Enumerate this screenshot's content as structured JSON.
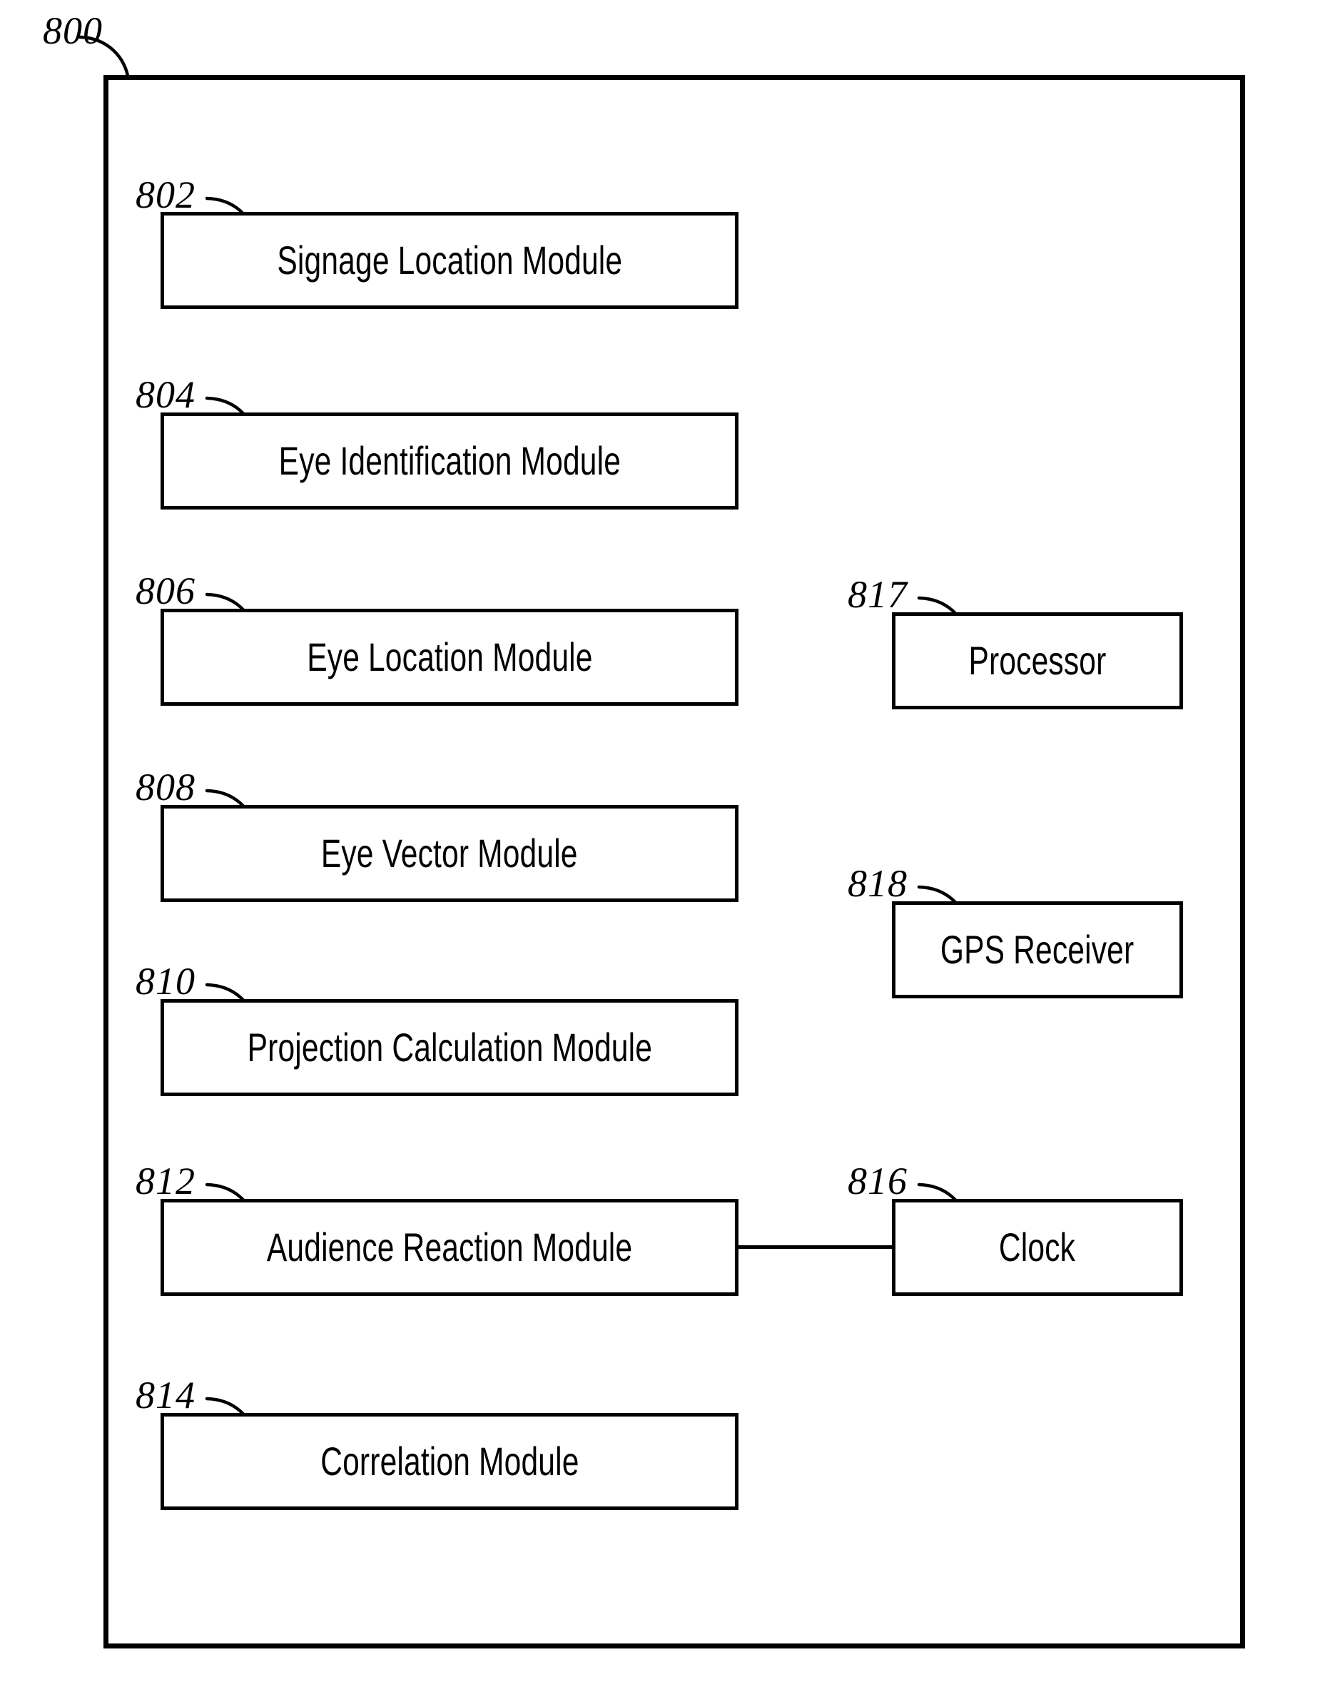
{
  "figure": {
    "system_ref": "800",
    "background_color": "#ffffff",
    "line_color": "#000000"
  },
  "modules": [
    {
      "ref": "802",
      "label": "Signage Location Module",
      "column": "left"
    },
    {
      "ref": "804",
      "label": "Eye Identification Module",
      "column": "left"
    },
    {
      "ref": "806",
      "label": "Eye Location Module",
      "column": "left"
    },
    {
      "ref": "808",
      "label": "Eye Vector Module",
      "column": "left"
    },
    {
      "ref": "810",
      "label": "Projection Calculation Module",
      "column": "left"
    },
    {
      "ref": "812",
      "label": "Audience Reaction Module",
      "column": "left"
    },
    {
      "ref": "814",
      "label": "Correlation Module",
      "column": "left"
    },
    {
      "ref": "817",
      "label": "Processor",
      "column": "right"
    },
    {
      "ref": "818",
      "label": "GPS Receiver",
      "column": "right"
    },
    {
      "ref": "816",
      "label": "Clock",
      "column": "right"
    }
  ],
  "connections": [
    {
      "from": "812",
      "to": "816",
      "style": "solid-horizontal"
    }
  ]
}
